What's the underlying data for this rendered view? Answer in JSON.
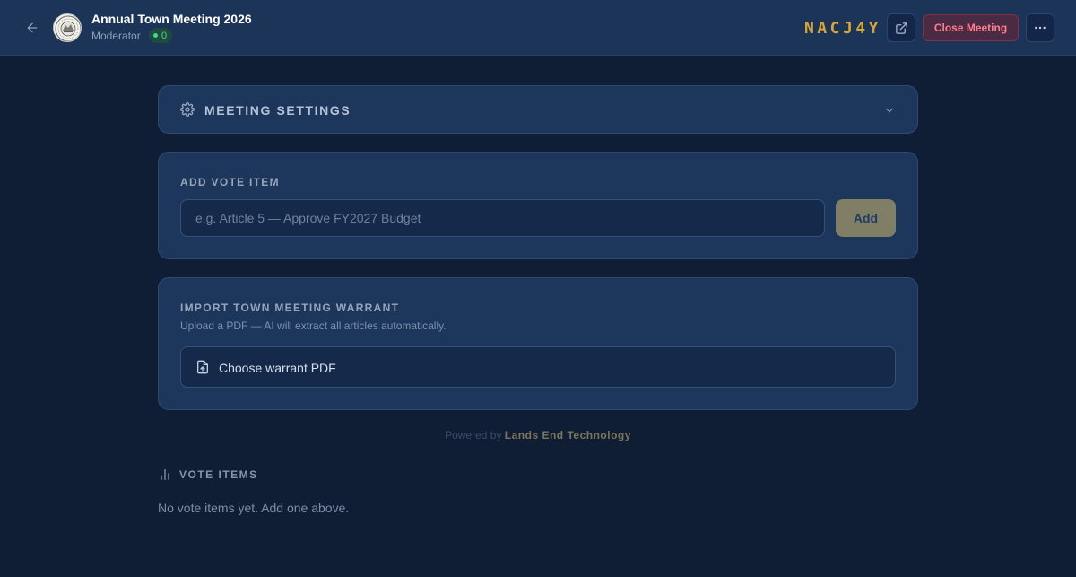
{
  "header": {
    "title": "Annual Town Meeting 2026",
    "role": "Moderator",
    "participant_count": "0",
    "meeting_code": "NACJ4Y",
    "close_label": "Close Meeting"
  },
  "settings": {
    "label": "MEETING SETTINGS"
  },
  "add_vote": {
    "label": "ADD VOTE ITEM",
    "placeholder": "e.g. Article 5 — Approve FY2027 Budget",
    "value": "",
    "button_label": "Add"
  },
  "import": {
    "label": "IMPORT TOWN MEETING WARRANT",
    "subtitle": "Upload a PDF — AI will extract all articles automatically.",
    "button_label": "Choose warrant PDF"
  },
  "footer": {
    "powered_prefix": "Powered by",
    "powered_brand": "Lands End Technology"
  },
  "votes": {
    "label": "VOTE ITEMS",
    "empty_message": "No vote items yet. Add one above."
  },
  "colors": {
    "background": "#0f1d35",
    "header": "#1b3458",
    "card": "#1d365c",
    "accent_gold": "#d4a63c",
    "danger": "#ff7d8c",
    "live_green": "#3ddc84"
  },
  "icons": {
    "back": "arrow-left-icon",
    "logo": "town-seal-logo",
    "external": "external-link-icon",
    "more": "more-horizontal-icon",
    "settings": "gear-icon",
    "chevron": "chevron-down-icon",
    "file": "file-upload-icon",
    "votes": "bar-chart-icon"
  }
}
